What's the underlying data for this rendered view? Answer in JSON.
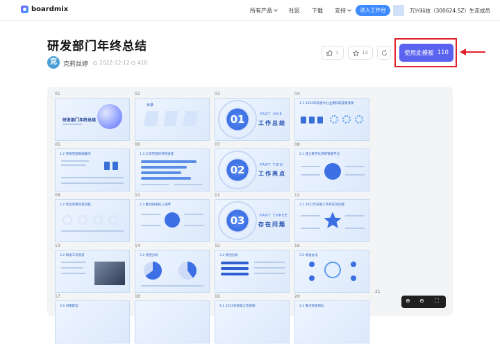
{
  "header": {
    "logo_text": "boardmix",
    "nav": [
      {
        "label": "所有产品",
        "has_dropdown": true
      },
      {
        "label": "社区",
        "has_dropdown": false
      },
      {
        "label": "下载",
        "has_dropdown": false
      },
      {
        "label": "支持",
        "has_dropdown": true
      }
    ],
    "enter_button": "进入工作台",
    "user_org": "万兴科技（300624.SZ）生态成员"
  },
  "template": {
    "title": "研发部门年终总结",
    "author_initial": "克",
    "author": "克莉丝婷",
    "date": "2022-12-12",
    "views": "410",
    "likes": "1",
    "stars": "13",
    "use_button_label": "使用此模板",
    "use_count": "110"
  },
  "slides": [
    {
      "num": "01",
      "caption": "研发部门年终总结"
    },
    {
      "num": "02",
      "caption": "目录"
    },
    {
      "num": "03",
      "caption": "PART ONE 工作总结",
      "big": "01"
    },
    {
      "num": "04",
      "caption": "1.1 2022年研发中心主要科研成果清单"
    },
    {
      "num": "05",
      "caption": "1.2 项目完成数据概况"
    },
    {
      "num": "06",
      "caption": "1.3 工作完成的项目进度"
    },
    {
      "num": "07",
      "caption": "PART TWO 工作亮点",
      "big": "02"
    },
    {
      "num": "08",
      "caption": "2.1 建立数字化项目管理平台"
    },
    {
      "num": "09",
      "caption": "2.2 优化项目开发流程"
    },
    {
      "num": "10",
      "caption": "2.3 推动研发投入效用"
    },
    {
      "num": "11",
      "caption": "PART THREE 存在问题",
      "big": "03"
    },
    {
      "num": "12",
      "caption": "3.1 2022年研发工作存在的问题"
    },
    {
      "num": "13",
      "caption": "3.2 研发工作反思"
    },
    {
      "num": "14",
      "caption": "3.2 原因分析"
    },
    {
      "num": "15",
      "caption": "3.4 原因分析"
    },
    {
      "num": "16",
      "caption": "3.5 改进办法"
    },
    {
      "num": "17",
      "caption": "3.6 对策建议"
    },
    {
      "num": "18",
      "caption": ""
    },
    {
      "num": "19",
      "caption": "4.1 2023年研发工作安排"
    },
    {
      "num": "20",
      "caption": "4.2 重点研发目标"
    },
    {
      "num": "21",
      "caption": ""
    }
  ],
  "colors": {
    "accent": "#5a62f0",
    "highlight": "#e0202a",
    "enter": "#3d8bff"
  }
}
